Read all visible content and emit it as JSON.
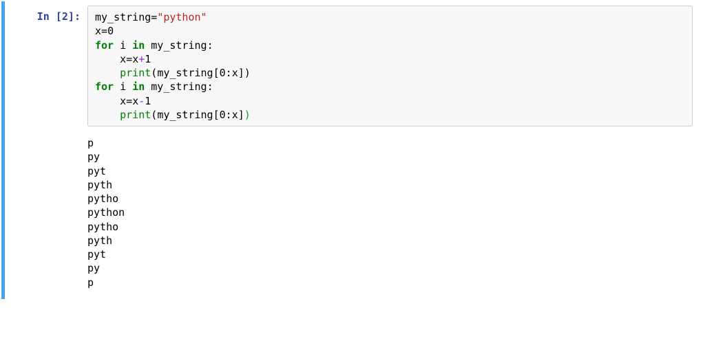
{
  "prompt": "In [2]:",
  "code": {
    "l1": {
      "var": "my_string",
      "eq": "=",
      "str": "\"python\""
    },
    "l2": {
      "var": "x",
      "eq": "=",
      "num": "0"
    },
    "l3": {
      "for": "for",
      "i": "i",
      "in": "in",
      "it": "my_string",
      "colon": ":"
    },
    "l4": {
      "indent": "    ",
      "x1": "x",
      "eq": "=",
      "x2": "x",
      "plus": "+",
      "one": "1"
    },
    "l5": {
      "indent": "    ",
      "print": "print",
      "lp": "(",
      "var": "my_string",
      "lb": "[",
      "z": "0",
      "colon": ":",
      "x": "x",
      "rb": "]",
      "rp": ")"
    },
    "l6": {
      "for": "for",
      "i": "i",
      "in": "in",
      "it": "my_string",
      "colon": ":"
    },
    "l7": {
      "indent": "    ",
      "x1": "x",
      "eq": "=",
      "x2": "x",
      "minus": "-",
      "one": "1"
    },
    "l8": {
      "indent": "    ",
      "print": "print",
      "lp": "(",
      "var": "my_string",
      "lb": "[",
      "z": "0",
      "colon": ":",
      "x": "x",
      "rb": "]",
      "rp": ")"
    }
  },
  "output": {
    "o1": "p",
    "o2": "py",
    "o3": "pyt",
    "o4": "pyth",
    "o5": "pytho",
    "o6": "python",
    "o7": "pytho",
    "o8": "pyth",
    "o9": "pyt",
    "o10": "py",
    "o11": "p"
  }
}
